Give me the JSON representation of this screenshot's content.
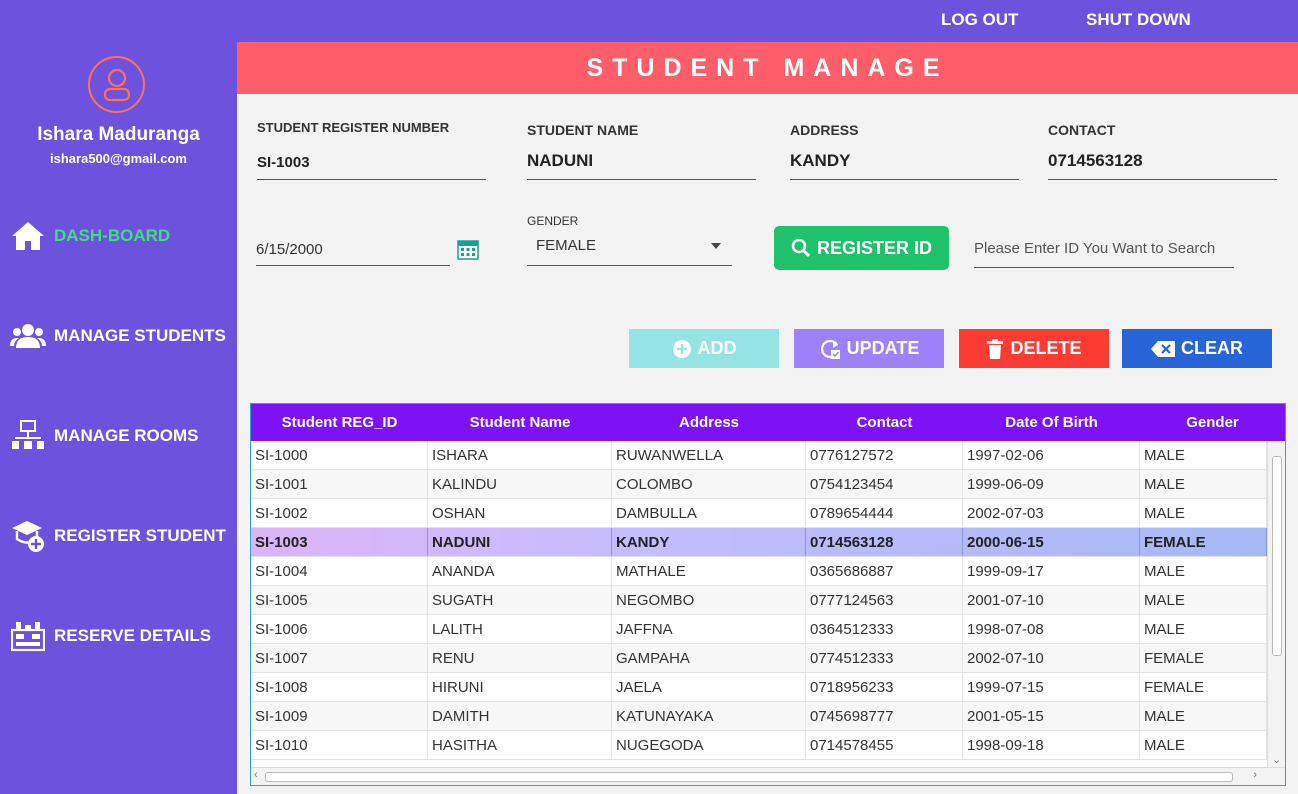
{
  "topbar": {
    "logout": "LOG OUT",
    "shutdown": "SHUT DOWN"
  },
  "user": {
    "name": "Ishara Maduranga",
    "email": "ishara500@gmail.com"
  },
  "sidebar": {
    "items": [
      {
        "label": "DASH-BOARD",
        "icon": "home-icon"
      },
      {
        "label": "MANAGE  STUDENTS",
        "icon": "users-icon"
      },
      {
        "label": "MANAGE ROOMS",
        "icon": "rooms-icon"
      },
      {
        "label": "REGISTER  STUDENT",
        "icon": "graduate-add-icon"
      },
      {
        "label": "RESERVE DETAILS",
        "icon": "reserve-icon"
      }
    ]
  },
  "page": {
    "title": "STUDENT MANAGE"
  },
  "form": {
    "reg_label": "STUDENT REGISTER NUMBER",
    "reg_value": "SI-1003",
    "name_label": "STUDENT NAME",
    "name_value": "NADUNI",
    "address_label": "ADDRESS",
    "address_value": "KANDY",
    "contact_label": "CONTACT",
    "contact_value": "0714563128",
    "dob_value": "6/15/2000",
    "gender_label": "GENDER",
    "gender_value": "FEMALE",
    "register_btn": "REGISTER ID",
    "search_placeholder": "Please Enter ID You Want to Search"
  },
  "actions": {
    "add": "ADD",
    "update": "UPDATE",
    "delete": "DELETE",
    "clear": "CLEAR"
  },
  "colors": {
    "accent": "#6c52dc",
    "title": "#fe5d6a",
    "register": "#1fc16a",
    "add": "#95e3e3",
    "update": "#9d82f9",
    "delete": "#fc3c33",
    "clear": "#2664d8",
    "table_header": "#7c13f6"
  },
  "table": {
    "headers": [
      "Student REG_ID",
      "Student Name",
      "Address",
      "Contact",
      "Date Of Birth",
      "Gender"
    ],
    "rows": [
      [
        "SI-1000",
        "ISHARA",
        "RUWANWELLA",
        "0776127572",
        "1997-02-06",
        "MALE"
      ],
      [
        "SI-1001",
        "KALINDU",
        "COLOMBO",
        "0754123454",
        "1999-06-09",
        "MALE"
      ],
      [
        "SI-1002",
        "OSHAN",
        "DAMBULLA",
        "0789654444",
        "2002-07-03",
        "MALE"
      ],
      [
        "SI-1003",
        "NADUNI",
        "KANDY",
        "0714563128",
        "2000-06-15",
        "FEMALE"
      ],
      [
        "SI-1004",
        "ANANDA",
        "MATHALE",
        "0365686887",
        "1999-09-17",
        "MALE"
      ],
      [
        "SI-1005",
        "SUGATH",
        "NEGOMBO",
        "0777124563",
        "2001-07-10",
        "MALE"
      ],
      [
        "SI-1006",
        "LALITH",
        "JAFFNA",
        "0364512333",
        "1998-07-08",
        "MALE"
      ],
      [
        "SI-1007",
        "RENU",
        "GAMPAHA",
        "0774512333",
        "2002-07-10",
        "FEMALE"
      ],
      [
        "SI-1008",
        "HIRUNI",
        "JAELA",
        "0718956233",
        "1999-07-15",
        "FEMALE"
      ],
      [
        "SI-1009",
        "DAMITH",
        "KATUNAYAKA",
        "0745698777",
        "2001-05-15",
        "MALE"
      ],
      [
        "SI-1010",
        "HASITHA",
        "NUGEGODA",
        "0714578455",
        "1998-09-18",
        "MALE"
      ]
    ],
    "selected_row": 3
  }
}
